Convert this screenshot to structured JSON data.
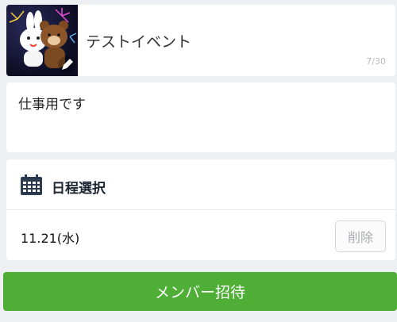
{
  "event": {
    "title": "テストイベント",
    "title_counter": "7/30",
    "description": "仕事用です"
  },
  "schedule": {
    "header": "日程選択",
    "dates": [
      {
        "label": "11.21(水)",
        "delete_label": "削除"
      }
    ]
  },
  "actions": {
    "invite_label": "メンバー招待"
  },
  "icons": {
    "thumbnail": "brown-cony-fireworks-sticker",
    "calendar": "calendar-icon",
    "edit": "pencil-icon"
  },
  "colors": {
    "accent_green": "#4fae36",
    "calendar_icon": "#2b3a4e",
    "page_background": "#eef0f3"
  }
}
